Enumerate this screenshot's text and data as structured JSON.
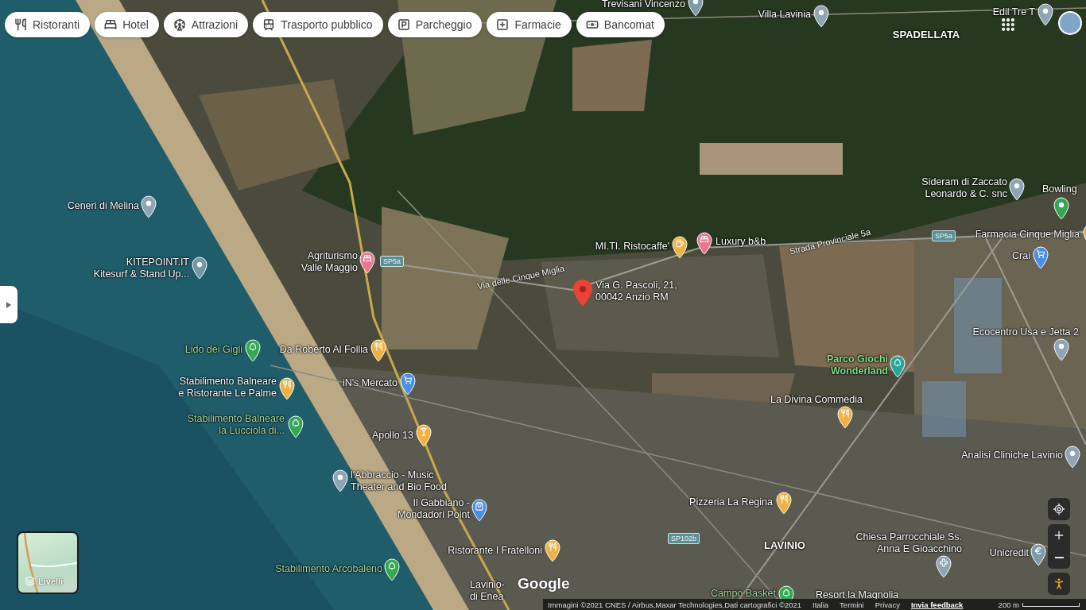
{
  "category_chips": [
    {
      "kind": "restaurants",
      "label": "Ristoranti"
    },
    {
      "kind": "hotels",
      "label": "Hotel"
    },
    {
      "kind": "attractions",
      "label": "Attrazioni"
    },
    {
      "kind": "transit",
      "label": "Trasporto pubblico"
    },
    {
      "kind": "parking",
      "label": "Parcheggio"
    },
    {
      "kind": "pharmacy",
      "label": "Farmacie"
    },
    {
      "kind": "atm",
      "label": "Bancomat"
    }
  ],
  "places": [
    {
      "kind": "generic",
      "color": "#7f9ba8",
      "label": [
        "Trevisani Vincenzo"
      ]
    },
    {
      "kind": "generic",
      "color": "#8fa4b4",
      "label": [
        "Villa Lavinia"
      ]
    },
    {
      "kind": "generic",
      "color": "#8fa4b4",
      "label": [
        "Edil Tre T"
      ]
    },
    {
      "kind": "area",
      "label": [
        "SPADELLATA"
      ]
    },
    {
      "kind": "generic",
      "color": "#8fa4b4",
      "label": [
        "Ceneri di Melina"
      ]
    },
    {
      "kind": "generic",
      "color": "#6f9aa5",
      "label": [
        "KITEPOINT.IT",
        "Kitesurf & Stand Up..."
      ]
    },
    {
      "kind": "hotel",
      "color": "#e8778f",
      "label": [
        "Agriturismo",
        "Valle Maggio"
      ]
    },
    {
      "kind": "cafe",
      "color": "#f0b143",
      "label": [
        "MI.TI. Ristocaffe'"
      ]
    },
    {
      "kind": "hotel",
      "color": "#e8778f",
      "label": [
        "Luxury b&b"
      ]
    },
    {
      "kind": "address",
      "color": "#ea4335",
      "label": [
        "Via G. Pascoli, 21,",
        "00042 Anzio RM"
      ]
    },
    {
      "kind": "generic",
      "color": "#8fa4b4",
      "label": [
        "Sideram di Zaccato",
        "Leonardo & C. snc"
      ]
    },
    {
      "kind": "generic",
      "color": "#34a853",
      "label": [
        "Bowling"
      ]
    },
    {
      "kind": "generic",
      "color": "#e9a23b",
      "label": [
        "Farmacia Cinque Miglia"
      ]
    },
    {
      "kind": "shop",
      "color": "#4a8fe7",
      "label": [
        "Crai"
      ]
    },
    {
      "kind": "generic",
      "color": "#8fa4b4",
      "label": [
        "Ecocentro Usa e Jetta 2"
      ]
    },
    {
      "kind": "park",
      "color": "#26a69a",
      "label": [
        "Parco Giochi",
        "Wonderland"
      ]
    },
    {
      "kind": "food",
      "color": "#f0b143",
      "label": [
        "La Divina Commedia"
      ]
    },
    {
      "kind": "park",
      "color": "#34a853",
      "label": [
        "Lido dei Gigli"
      ]
    },
    {
      "kind": "food",
      "color": "#f0b143",
      "label": [
        "Da Roberto Al Follia"
      ]
    },
    {
      "kind": "food",
      "color": "#f0b143",
      "label": [
        "Stabilimento Balneare",
        "e Ristorante Le Palme"
      ]
    },
    {
      "kind": "shop",
      "color": "#4a8fe7",
      "label": [
        "iN's Mercato"
      ]
    },
    {
      "kind": "park",
      "color": "#34a853",
      "label": [
        "Stabilimento Balneare",
        "la Lucciola di..."
      ]
    },
    {
      "kind": "bar",
      "color": "#f0b143",
      "label": [
        "Apollo 13"
      ]
    },
    {
      "kind": "generic",
      "color": "#8fa4b4",
      "label": [
        "l'Abbraccio - Music",
        "Theater and Bio Food"
      ]
    },
    {
      "kind": "bag",
      "color": "#4a8fe7",
      "label": [
        "Il Gabbiano -",
        "Mondadori Point"
      ]
    },
    {
      "kind": "food",
      "color": "#f0b143",
      "label": [
        "Pizzeria La Regina"
      ]
    },
    {
      "kind": "generic",
      "color": "#8fa4b4",
      "label": [
        "Analisi Cliniche Lavinio"
      ]
    },
    {
      "kind": "food",
      "color": "#f0b143",
      "label": [
        "Ristorante I Fratelloni"
      ]
    },
    {
      "kind": "area",
      "label": [
        "LAVINIO"
      ]
    },
    {
      "kind": "church",
      "color": "#8fa4b4",
      "label": [
        "Chiesa Parrocchiale Ss.",
        "Anna E Gioacchino"
      ]
    },
    {
      "kind": "bank",
      "color": "#7f9ba8",
      "label": [
        "Unicredit"
      ]
    },
    {
      "kind": "park",
      "color": "#34a853",
      "label": [
        "Stabilimento Arcobaleno"
      ]
    },
    {
      "kind": "plain",
      "label": [
        "Lavinio-",
        "di Enea"
      ]
    },
    {
      "kind": "park",
      "color": "#34a853",
      "label": [
        "Campo Basket"
      ]
    },
    {
      "kind": "plain",
      "label": [
        "Resort la Magnolia"
      ]
    }
  ],
  "road_labels": [
    "Via delle Cinque Miglia",
    "Strada Provinciale 5a"
  ],
  "road_shields": [
    "SP5a",
    "SP5a",
    "SP102b"
  ],
  "layers_button": {
    "label": "Livelli"
  },
  "logo": "Google",
  "bottom_bar": {
    "attribution": "Immagini ©2021 CNES / Airbus,Maxar Technologies,Dati cartografici ©2021",
    "links": [
      "Italia",
      "Termini",
      "Privacy"
    ],
    "feedback": "Invia feedback",
    "scale": "200 m"
  }
}
